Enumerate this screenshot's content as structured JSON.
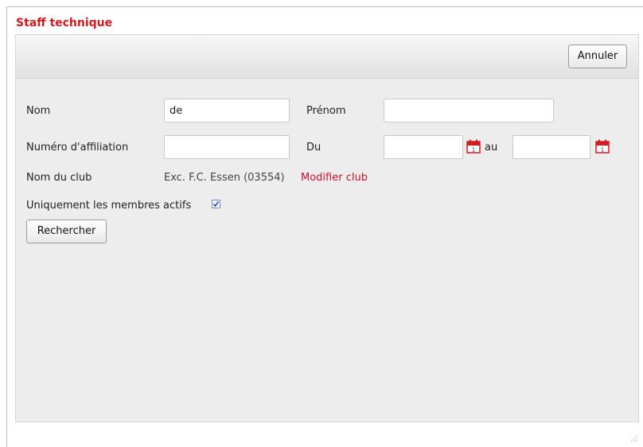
{
  "dialog": {
    "title": "Staff technique"
  },
  "toolbar": {
    "cancel_label": "Annuler"
  },
  "form": {
    "nom_label": "Nom",
    "nom_value": "de",
    "prenom_label": "Prénom",
    "prenom_value": "",
    "affiliation_label": "Numéro d'affiliation",
    "affiliation_value": "",
    "du_label": "Du",
    "du_value": "",
    "au_label": "au",
    "au_value": "",
    "club_label": "Nom du club",
    "club_value": "Exc. F.C. Essen (03554)",
    "modify_club_link": "Modifier club",
    "active_members_label": "Uniquement les membres actifs",
    "active_members_checked": true,
    "search_button": "Rechercher"
  },
  "icons": {
    "calendar": "calendar-icon",
    "checkmark": "check-icon"
  },
  "colors": {
    "accent": "#d71920",
    "link": "#c8102e",
    "panel_bg": "#ededed"
  }
}
